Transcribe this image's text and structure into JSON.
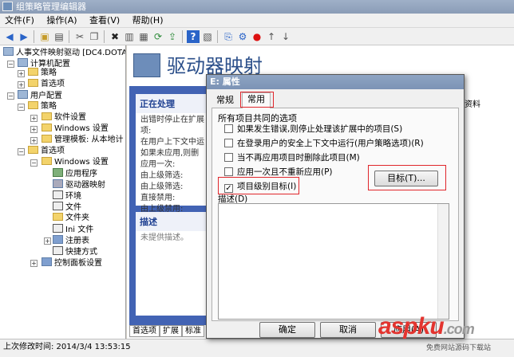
{
  "window": {
    "title": "组策略管理编辑器"
  },
  "menu": [
    "文件(F)",
    "操作(A)",
    "查看(V)",
    "帮助(H)"
  ],
  "tree": {
    "root": "人事文件映射驱动 [DC4.DOTA.C",
    "computer_config": "计算机配置",
    "policies1": "策略",
    "prefs1": "首选项",
    "user_config": "用户配置",
    "policies2": "策略",
    "software": "软件设置",
    "windows_settings": "Windows 设置",
    "admin_templates": "管理模板: 从本地计",
    "prefs2": "首选项",
    "windows_settings2": "Windows 设置",
    "apps": "应用程序",
    "drive_maps": "驱动器映射",
    "env": "环境",
    "files": "文件",
    "folders": "文件夹",
    "ini": "Ini 文件",
    "registry": "注册表",
    "shortcuts": "快捷方式",
    "control_panel": "控制面板设置"
  },
  "main": {
    "title": "驱动器映射",
    "processing": {
      "heading": "正在处理",
      "lines": [
        "出错时停止在扩展",
        "项:",
        "在用户上下文中运",
        "如果未应用,则删",
        "应用一次:",
        "由上级筛选:",
        "由上级筛选:",
        "直接禁用:",
        "由上级禁用:"
      ]
    },
    "description": {
      "heading": "描述",
      "text": "未提供描述。"
    },
    "column_fragment": "资料",
    "bottom_tabs": [
      "首选项",
      "扩展",
      "标准"
    ]
  },
  "status": {
    "text": "上次修改时间: 2014/3/4 13:53:15"
  },
  "dialog": {
    "title": "E: 属性",
    "tabs": [
      "常规",
      "常用"
    ],
    "group_label": "所有项目共同的选项",
    "options": [
      {
        "label": "如果发生错误,则停止处理该扩展中的项目(S)",
        "checked": false
      },
      {
        "label": "在登录用户的安全上下文中运行(用户策略选项)(R)",
        "checked": false
      },
      {
        "label": "当不再应用项目时删除此项目(M)",
        "checked": false
      },
      {
        "label": "应用一次且不重新应用(P)",
        "checked": false
      },
      {
        "label": "项目级别目标(I)",
        "checked": true
      }
    ],
    "targeting_button": "目标(T)...",
    "description_label": "描述(D)",
    "ok": "确定",
    "cancel": "取消",
    "apply": "应用(A)"
  },
  "watermark": {
    "brand": "aspku",
    "suffix": ".com",
    "tagline": "免费网站源码下载站"
  }
}
